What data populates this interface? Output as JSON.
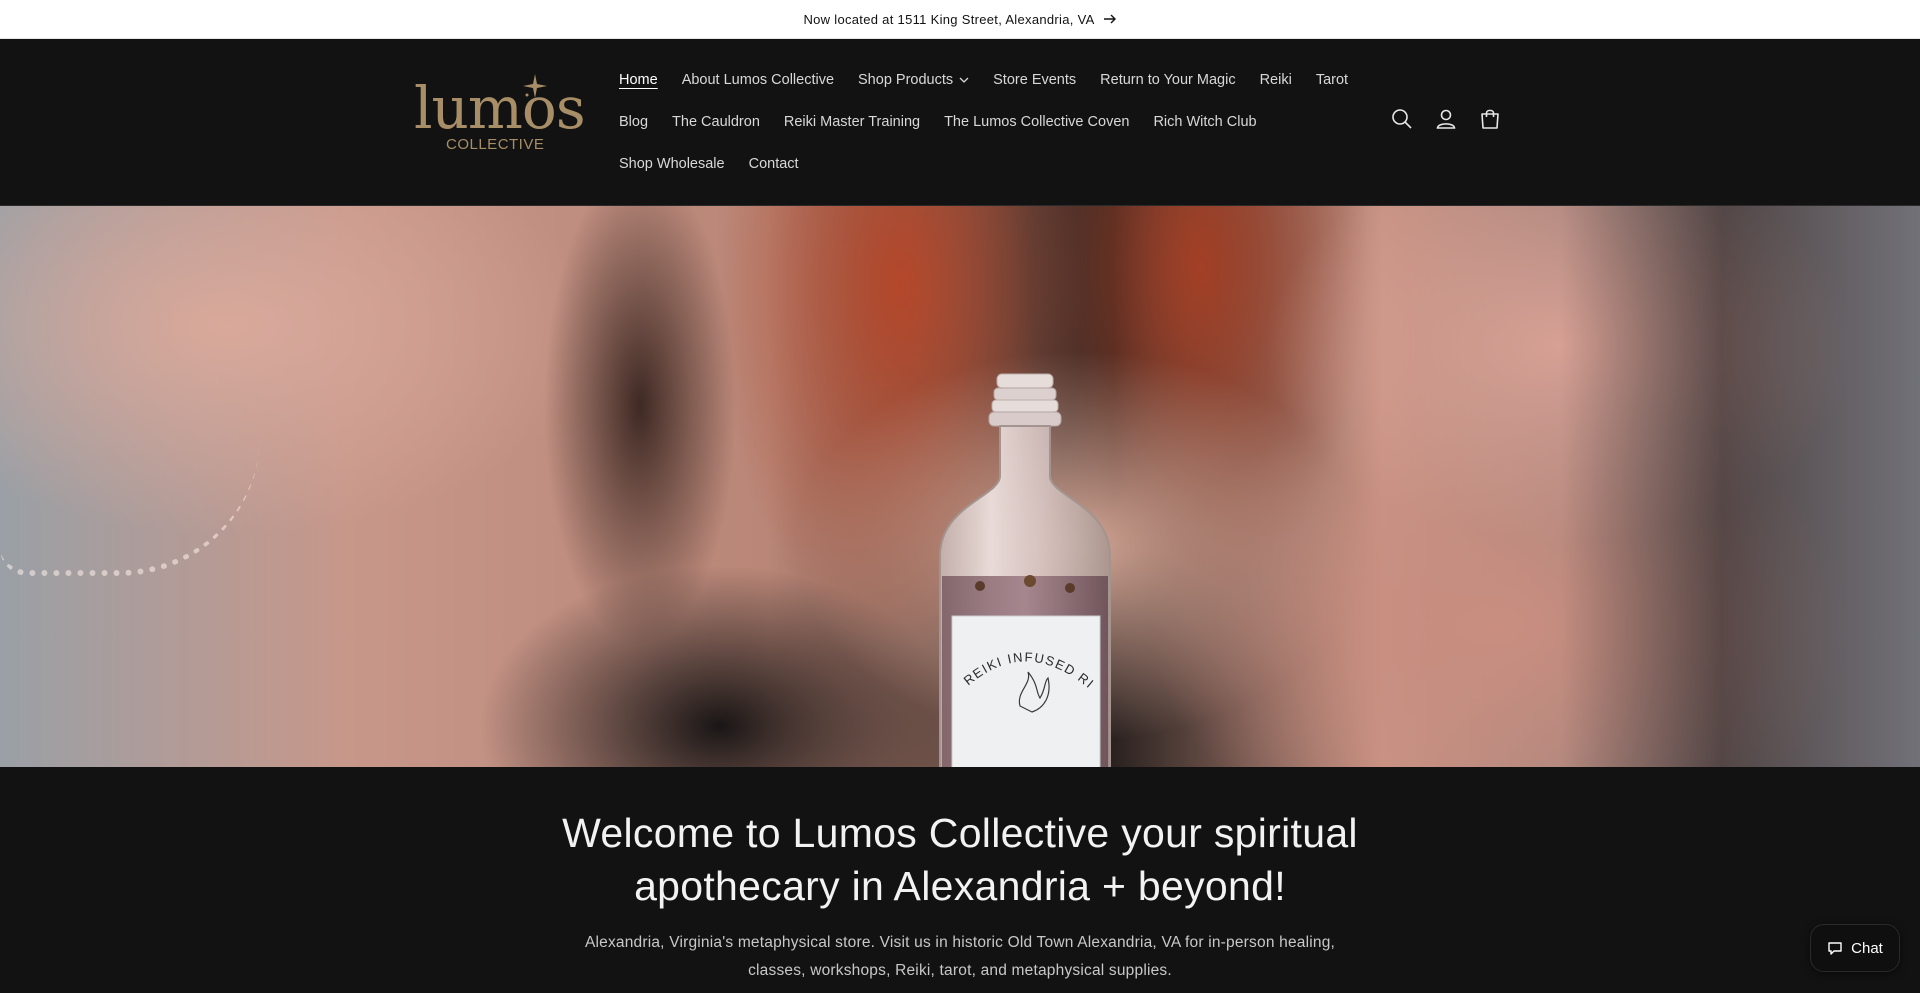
{
  "announcement": {
    "text": "Now located at 1511 King Street, Alexandria, VA",
    "icon": "arrow-right-icon"
  },
  "logo": {
    "word": "lumos",
    "sub": "COLLECTIVE",
    "color": "#a88e66"
  },
  "nav": {
    "items": [
      {
        "label": "Home",
        "active": true
      },
      {
        "label": "About Lumos Collective"
      },
      {
        "label": "Shop Products",
        "has_dropdown": true
      },
      {
        "label": "Store Events"
      },
      {
        "label": "Return to Your Magic"
      },
      {
        "label": "Reiki"
      },
      {
        "label": "Tarot"
      },
      {
        "label": "Blog"
      },
      {
        "label": "The Cauldron"
      },
      {
        "label": "Reiki Master Training"
      },
      {
        "label": "The Lumos Collective Coven"
      },
      {
        "label": "Rich Witch Club"
      },
      {
        "label": "Shop Wholesale"
      },
      {
        "label": "Contact"
      }
    ]
  },
  "header_icons": [
    "search-icon",
    "account-icon",
    "cart-icon"
  ],
  "hero": {
    "bottle_label": "REIKI INFUSED RITUAL OIL"
  },
  "welcome": {
    "heading": "Welcome to Lumos Collective your spiritual apothecary in Alexandria + beyond!",
    "description": "Alexandria, Virginia's metaphysical store. Visit us in historic Old Town Alexandria, VA for in-person healing, classes, workshops, Reiki, tarot, and metaphysical supplies."
  },
  "chat": {
    "label": "Chat"
  },
  "colors": {
    "background": "#121212",
    "announcement_bg": "#ffffff",
    "accent": "#a88e66"
  }
}
